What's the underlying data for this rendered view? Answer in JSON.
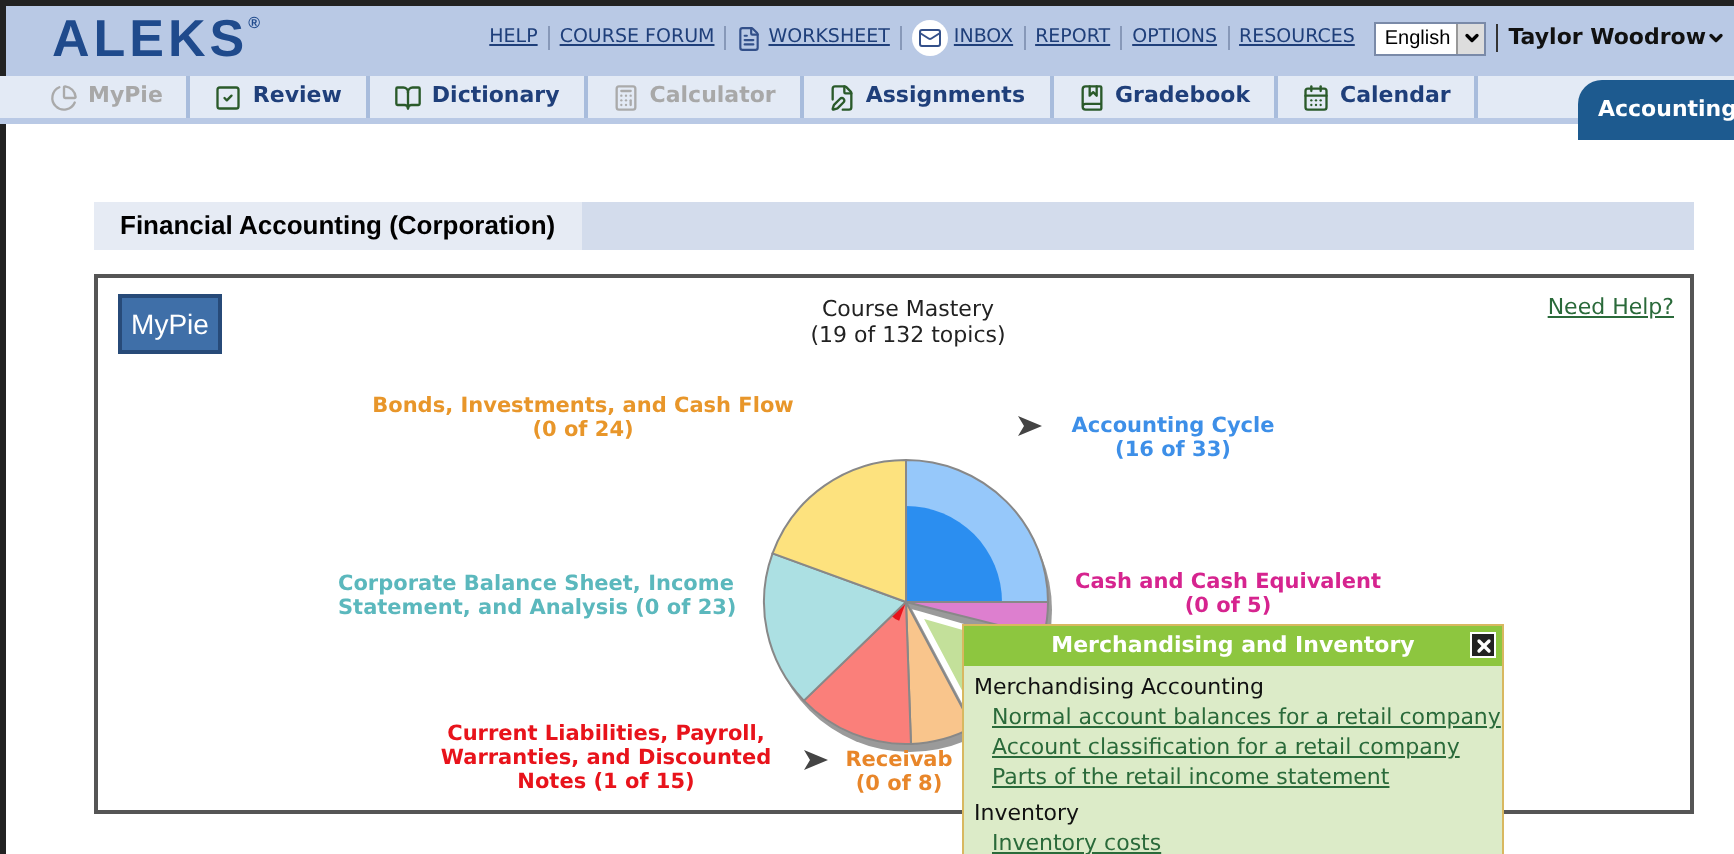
{
  "header": {
    "logo": "ALEKS",
    "logo_mark": "®",
    "links": [
      "HELP",
      "COURSE FORUM",
      "WORKSHEET",
      "INBOX",
      "REPORT",
      "OPTIONS",
      "RESOURCES"
    ],
    "language": "English",
    "user": "Taylor Woodrow"
  },
  "tabs": [
    {
      "label": "MyPie",
      "disabled": true
    },
    {
      "label": "Review",
      "disabled": false
    },
    {
      "label": "Dictionary",
      "disabled": false
    },
    {
      "label": "Calculator",
      "disabled": true
    },
    {
      "label": "Assignments",
      "disabled": false
    },
    {
      "label": "Gradebook",
      "disabled": false
    },
    {
      "label": "Calendar",
      "disabled": false
    }
  ],
  "course_tab": {
    "label": "Accounting"
  },
  "course_title": "Financial Accounting (Corporation)",
  "mypie_button": "MyPie",
  "mastery": {
    "title": "Course Mastery",
    "count": "(19 of 132 topics)"
  },
  "need_help": "Need Help?",
  "pie_labels": [
    {
      "name": "Bonds, Investments, and Cash Flow",
      "count": "(0 of 24)",
      "color": "#e8962a",
      "arrow": false
    },
    {
      "name": "Accounting Cycle",
      "count": "(16 of 33)",
      "color": "#3d8fe8",
      "arrow": true
    },
    {
      "name": "Corporate Balance Sheet, Income Statement, and Analysis (0 of 23)",
      "color": "#5bb8bd",
      "arrow": false
    },
    {
      "name": "Cash and Cash Equivalent",
      "count": "(0 of 5)",
      "color": "#d6248f",
      "arrow": false
    },
    {
      "name": "Current Liabilities, Payroll, Warranties, and Discounted Notes (1 of 15)",
      "color": "#e8131b",
      "arrow": false
    },
    {
      "name": "Receivab",
      "count": "(0 of 8)",
      "color": "#e8862a",
      "arrow": true
    }
  ],
  "popup": {
    "title": "Merchandising and Inventory",
    "sections": [
      {
        "heading": "Merchandising Accounting",
        "links": [
          "Normal account balances for a retail company",
          "Account classification for a retail company",
          "Parts of the retail income statement"
        ]
      },
      {
        "heading": "Inventory",
        "links": [
          "Inventory costs"
        ]
      }
    ]
  }
}
